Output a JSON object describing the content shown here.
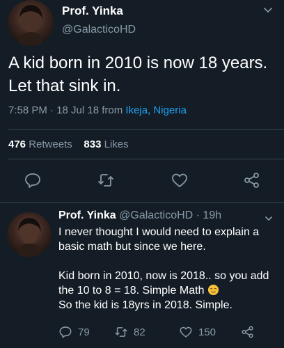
{
  "main_tweet": {
    "author_name": "Prof. Yinka",
    "author_handle": "@GalacticoHD",
    "text": "A kid born in 2010 is now 18 years. Let that sink in.",
    "time": "7:58 PM · 18 Jul 18 from ",
    "location": "Ikeja, Nigeria",
    "retweets_count": "476",
    "retweets_label": "Retweets",
    "likes_count": "833",
    "likes_label": "Likes",
    "icons": [
      "reply-icon",
      "retweet-icon",
      "like-icon",
      "share-icon",
      "chevron-down-icon"
    ]
  },
  "reply_tweet": {
    "author_name": "Prof. Yinka",
    "author_handle": "@GalacticoHD",
    "time_sep": " · ",
    "time": "19h",
    "line1": "I never thought I would need to explain a basic math but since we here.",
    "line2a": "Kid born in 2010, now is 2018.. so you add the 10 to 8 = 18. Simple Math ",
    "line2b": "So the kid is 18yrs in 2018. Simple.",
    "reply_count": "79",
    "retweet_count": "82",
    "like_count": "150"
  },
  "colors": {
    "background": "#141d26",
    "secondary_text": "#8899a6",
    "link": "#1da1f2",
    "divider": "#38444d"
  }
}
